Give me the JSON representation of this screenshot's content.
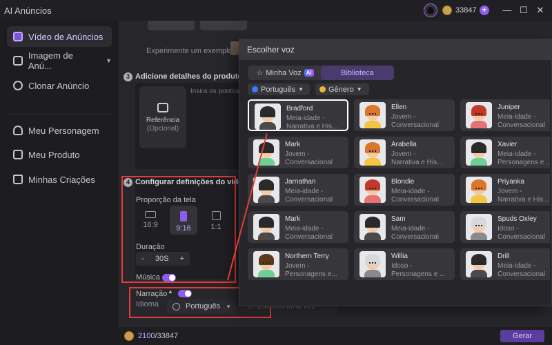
{
  "app": {
    "title": "AI Anúncios",
    "credits": "33847"
  },
  "sidebar": {
    "items": [
      {
        "label": "Vídeo de Anúncios",
        "icon": "video-bag-icon",
        "active": true
      },
      {
        "label": "Imagem de Anú...",
        "icon": "image-icon",
        "has_caret": true
      },
      {
        "label": "Clonar Anúncio",
        "icon": "clone-icon"
      },
      {
        "label": "Meu Personagem",
        "icon": "person-icon"
      },
      {
        "label": "Meu Produto",
        "icon": "product-icon"
      },
      {
        "label": "Minhas Criações",
        "icon": "folder-icon"
      }
    ]
  },
  "main": {
    "example_hint": "Experimente um exemplo:",
    "step3": {
      "num": "3",
      "title": "Adicione detalhes do produto e"
    },
    "reference": {
      "label": "Referência",
      "sub": "(Opcional)"
    },
    "details_placeholder": "Insira os pontos",
    "step4": {
      "num": "4",
      "title": "Configurar definições do vídeo"
    },
    "ratio_label": "Proporção da tela",
    "ratios": [
      {
        "label": "16:9",
        "selected": false
      },
      {
        "label": "9:16",
        "selected": true
      },
      {
        "label": "1:1",
        "selected": false
      }
    ],
    "duration_label": "Duração",
    "duration": {
      "minus": "-",
      "value": "30S",
      "plus": "+"
    },
    "music_label": "Música",
    "music_on": true,
    "narration_label": "Narração",
    "narration_on": true,
    "language_label": "Idioma",
    "language_value": "Português",
    "voice_placeholder": "Escolha uma voz",
    "credit_used": "2100",
    "credit_total": "/33847",
    "generate": "Gerar"
  },
  "dialog": {
    "title": "Escolher voz",
    "tabs": {
      "mine": "Minha Voz",
      "ai_badge": "AI",
      "library": "Biblioteca"
    },
    "filters": {
      "language": "Português",
      "gender": "Gênero"
    },
    "voices": [
      {
        "name": "Bradford",
        "meta1": "Meia-idade -",
        "meta2": "Narrativa e His...",
        "selected": true,
        "hair": "#2a2a2a",
        "shirt": "#4a4a4a"
      },
      {
        "name": "Ellen",
        "meta1": "Jovem -",
        "meta2": "Conversacional",
        "hair": "#d9772e",
        "shirt": "#f2c640"
      },
      {
        "name": "Juniper",
        "meta1": "Meia-idade -",
        "meta2": "Conversacional",
        "hair": "#c0392b",
        "shirt": "#e57373"
      },
      {
        "name": "Mark",
        "meta1": "Jovem -",
        "meta2": "Conversacional",
        "hair": "#2a2a2a",
        "shirt": "#6fcf97"
      },
      {
        "name": "Arabella",
        "meta1": "Jovem -",
        "meta2": "Narrativa e His...",
        "hair": "#d9772e",
        "shirt": "#f2c640"
      },
      {
        "name": "Xavier",
        "meta1": "Meia-idade -",
        "meta2": "Personagens e ...",
        "hair": "#2a2a2a",
        "shirt": "#6fcf97"
      },
      {
        "name": "Jarnathan",
        "meta1": "Meia-idade -",
        "meta2": "Conversacional",
        "hair": "#2a2a2a",
        "shirt": "#4a4a4a"
      },
      {
        "name": "Blondie",
        "meta1": "Meia-idade -",
        "meta2": "Conversacional",
        "hair": "#c0392b",
        "shirt": "#e57373"
      },
      {
        "name": "Priyanka",
        "meta1": "Jovem -",
        "meta2": "Narrativa e His...",
        "hair": "#d9772e",
        "shirt": "#f2c640"
      },
      {
        "name": "Mark",
        "meta1": "Meia-idade -",
        "meta2": "Conversacional",
        "hair": "#2a2a2a",
        "shirt": "#4a4a4a"
      },
      {
        "name": "Sam",
        "meta1": "Meia-idade -",
        "meta2": "Conversacional",
        "hair": "#2a2a2a",
        "shirt": "#4a4a4a"
      },
      {
        "name": "Spuds Oxley",
        "meta1": "Idoso -",
        "meta2": "Conversacional",
        "hair": "#d8d8d8",
        "shirt": "#8a8a8a"
      },
      {
        "name": "Northern Terry",
        "meta1": "Jovem -",
        "meta2": "Personagens e...",
        "hair": "#5a3a1a",
        "shirt": "#6fcf97"
      },
      {
        "name": "Willia",
        "meta1": "Idoso -",
        "meta2": "Personagens e ...",
        "hair": "#d8d8d8",
        "shirt": "#8a8a8a"
      },
      {
        "name": "Drill",
        "meta1": "Meia-idade -",
        "meta2": "Conversacional",
        "hair": "#2a2a2a",
        "shirt": "#4a4a4a"
      }
    ]
  }
}
